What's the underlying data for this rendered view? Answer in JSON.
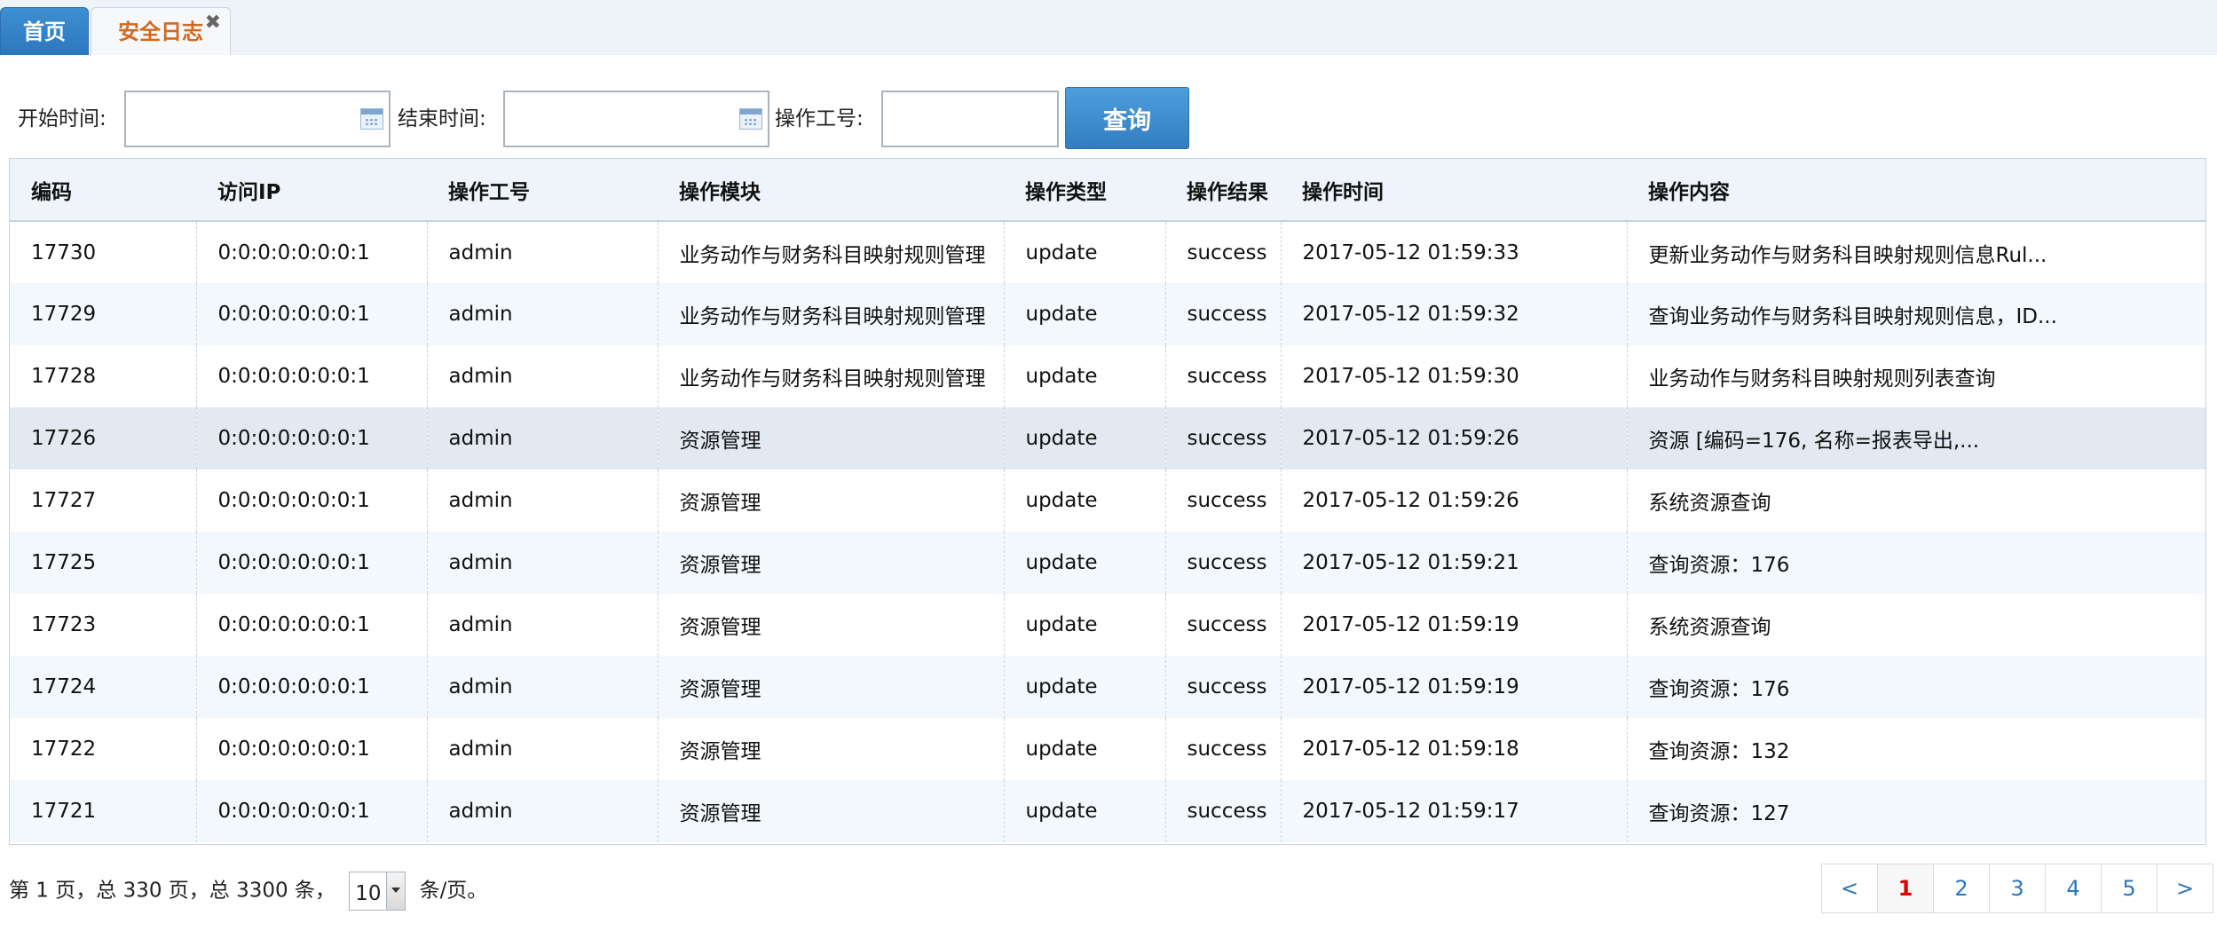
{
  "tabs": [
    {
      "label": "首页"
    },
    {
      "label": "安全日志",
      "close": "✖"
    }
  ],
  "search": {
    "start_label": "开始时间:",
    "end_label": "结束时间:",
    "operator_label": "操作工号:",
    "start_value": "",
    "end_value": "",
    "operator_value": "",
    "query_button": "查询"
  },
  "table": {
    "columns": [
      "编码",
      "访问IP",
      "操作工号",
      "操作模块",
      "操作类型",
      "操作结果",
      "操作时间",
      "操作内容"
    ],
    "rows": [
      [
        "17730",
        "0:0:0:0:0:0:0:1",
        "admin",
        "业务动作与财务科目映射规则管理",
        "update",
        "success",
        "2017-05-12 01:59:33",
        "更新业务动作与财务科目映射规则信息Rul..."
      ],
      [
        "17729",
        "0:0:0:0:0:0:0:1",
        "admin",
        "业务动作与财务科目映射规则管理",
        "update",
        "success",
        "2017-05-12 01:59:32",
        "查询业务动作与财务科目映射规则信息，ID..."
      ],
      [
        "17728",
        "0:0:0:0:0:0:0:1",
        "admin",
        "业务动作与财务科目映射规则管理",
        "update",
        "success",
        "2017-05-12 01:59:30",
        "业务动作与财务科目映射规则列表查询"
      ],
      [
        "17726",
        "0:0:0:0:0:0:0:1",
        "admin",
        "资源管理",
        "update",
        "success",
        "2017-05-12 01:59:26",
        "资源 [编码=176, 名称=报表导出,..."
      ],
      [
        "17727",
        "0:0:0:0:0:0:0:1",
        "admin",
        "资源管理",
        "update",
        "success",
        "2017-05-12 01:59:26",
        "系统资源查询"
      ],
      [
        "17725",
        "0:0:0:0:0:0:0:1",
        "admin",
        "资源管理",
        "update",
        "success",
        "2017-05-12 01:59:21",
        "查询资源：176"
      ],
      [
        "17723",
        "0:0:0:0:0:0:0:1",
        "admin",
        "资源管理",
        "update",
        "success",
        "2017-05-12 01:59:19",
        "系统资源查询"
      ],
      [
        "17724",
        "0:0:0:0:0:0:0:1",
        "admin",
        "资源管理",
        "update",
        "success",
        "2017-05-12 01:59:19",
        "查询资源：176"
      ],
      [
        "17722",
        "0:0:0:0:0:0:0:1",
        "admin",
        "资源管理",
        "update",
        "success",
        "2017-05-12 01:59:18",
        "查询资源：132"
      ],
      [
        "17721",
        "0:0:0:0:0:0:0:1",
        "admin",
        "资源管理",
        "update",
        "success",
        "2017-05-12 01:59:17",
        "查询资源：127"
      ]
    ],
    "selected_row": 3
  },
  "pager": {
    "info_before": "第 1 页，总 330 页，总 3300 条，",
    "page_size": "10",
    "info_after": "条/页。",
    "prev": "<",
    "pages": [
      "1",
      "2",
      "3",
      "4",
      "5"
    ],
    "current": "1",
    "next": ">"
  },
  "colors": {
    "tab_active": "#2b77bd",
    "tab_current_text": "#d2691e",
    "button": "#3a87c9",
    "current_page": "#e00000"
  }
}
